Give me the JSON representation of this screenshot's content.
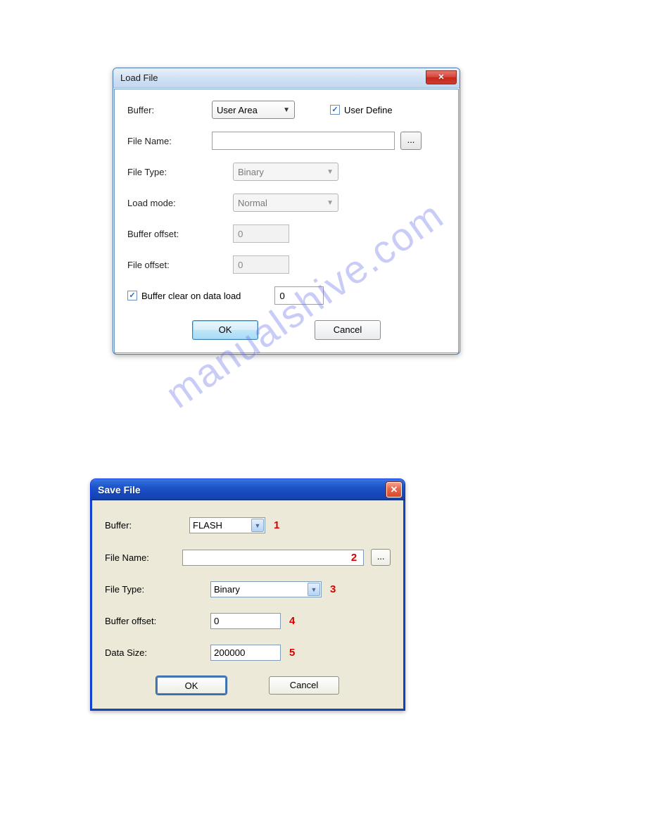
{
  "watermark_text": "manualshive.com",
  "dialog1": {
    "title": "Load File",
    "labels": {
      "buffer": "Buffer:",
      "file_name": "File Name:",
      "file_type": "File Type:",
      "load_mode": "Load mode:",
      "buffer_offset": "Buffer offset:",
      "file_offset": "File offset:",
      "buffer_clear": "Buffer clear on data load",
      "user_define": "User Define"
    },
    "values": {
      "buffer_selected": "User Area",
      "file_name_value": "",
      "file_type_selected": "Binary",
      "load_mode_selected": "Normal",
      "buffer_offset_value": "0",
      "file_offset_value": "0",
      "buffer_clear_value": "0",
      "user_define_checked": true,
      "buffer_clear_checked": true
    },
    "browse_label": "...",
    "ok_label": "OK",
    "cancel_label": "Cancel"
  },
  "dialog2": {
    "title": "Save File",
    "labels": {
      "buffer": "Buffer:",
      "file_name": "File Name:",
      "file_type": "File Type:",
      "buffer_offset": "Buffer offset:",
      "data_size": "Data Size:"
    },
    "values": {
      "buffer_selected": "FLASH",
      "file_name_value": "",
      "file_type_selected": "Binary",
      "buffer_offset_value": "0",
      "data_size_value": "200000"
    },
    "annotations": {
      "a1": "1",
      "a2": "2",
      "a3": "3",
      "a4": "4",
      "a5": "5"
    },
    "browse_label": "...",
    "ok_label": "OK",
    "cancel_label": "Cancel"
  }
}
